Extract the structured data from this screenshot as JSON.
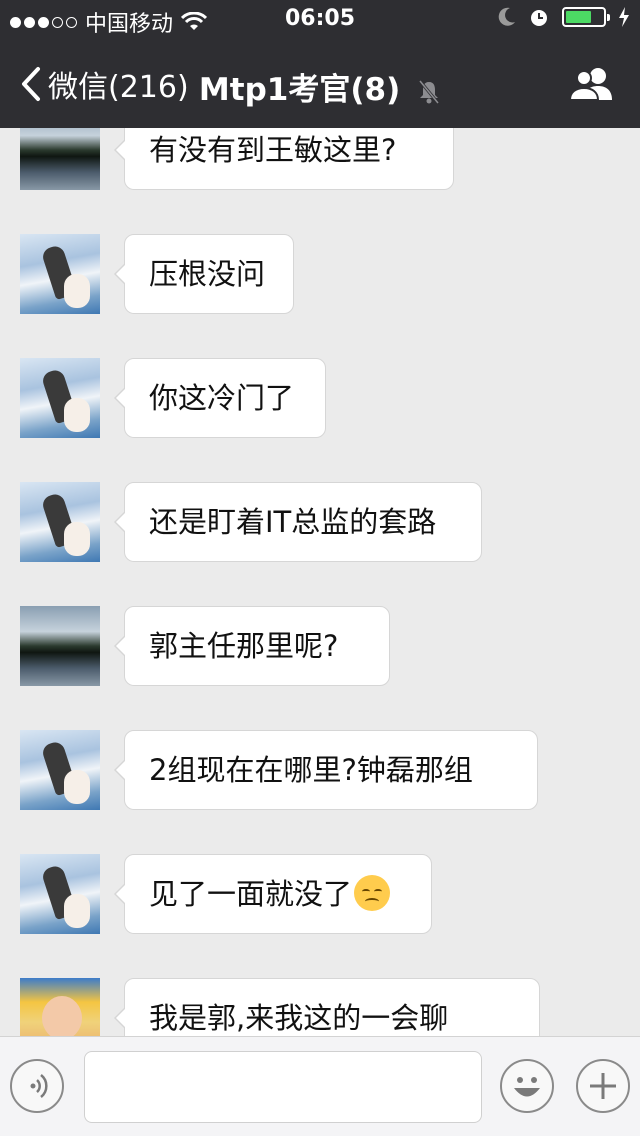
{
  "status_bar": {
    "carrier": "中国移动",
    "time": "06:05",
    "battery_color": "#4cd964",
    "battery_fraction": 0.7
  },
  "nav": {
    "back_label": "微信(216)",
    "title": "Mtp1考官(8)",
    "icons": [
      "back-chevron-icon",
      "mute-bell-icon",
      "group-members-icon"
    ]
  },
  "messages": [
    {
      "avatar": "lake",
      "text": "有没有到王敏这里?"
    },
    {
      "avatar": "sky",
      "text": "压根没问"
    },
    {
      "avatar": "sky",
      "text": "你这冷门了"
    },
    {
      "avatar": "sky",
      "text": "还是盯着IT总监的套路"
    },
    {
      "avatar": "lake",
      "text": "郭主任那里呢?"
    },
    {
      "avatar": "sky",
      "text": "2组现在在哪里?钟磊那组"
    },
    {
      "avatar": "sky",
      "text": "见了一面就没了",
      "emoji": "pensive-face-emoji"
    },
    {
      "avatar": "baby",
      "text": "我是郭,来我这的一会聊"
    }
  ],
  "input_bar": {
    "icons": [
      "voice-icon",
      "emoji-icon",
      "add-icon"
    ],
    "text_value": ""
  }
}
